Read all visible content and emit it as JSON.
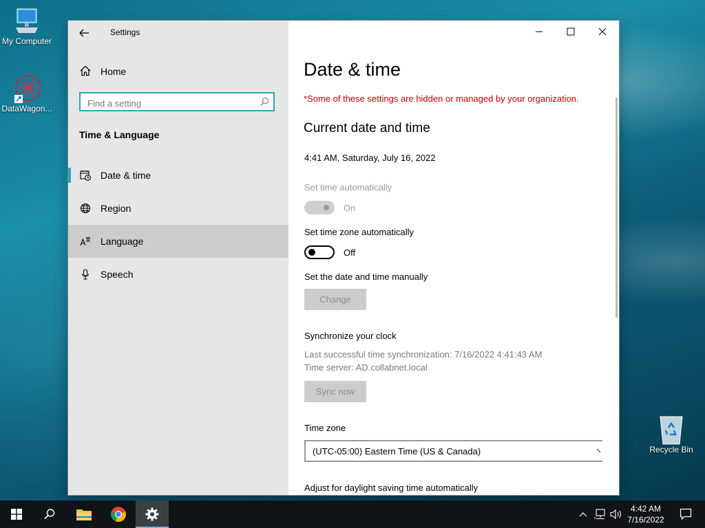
{
  "desktop": {
    "icons": [
      {
        "label": "My Computer",
        "icon": "computer-icon"
      },
      {
        "label": "DataWagon...",
        "icon": "datawagon-icon"
      },
      {
        "label": "Recycle Bin",
        "icon": "recycle-bin-icon"
      }
    ]
  },
  "window": {
    "title": "Settings",
    "controls": {
      "minimize": "minimize-icon",
      "maximize": "maximize-icon",
      "close": "close-icon"
    }
  },
  "sidebar": {
    "home_label": "Home",
    "search_placeholder": "Find a setting",
    "section_title": "Time & Language",
    "items": [
      {
        "label": "Date & time",
        "icon": "calendar-clock-icon",
        "selected": true
      },
      {
        "label": "Region",
        "icon": "globe-icon"
      },
      {
        "label": "Language",
        "icon": "language-icon",
        "hover": true
      },
      {
        "label": "Speech",
        "icon": "microphone-icon"
      }
    ]
  },
  "content": {
    "page_title": "Date & time",
    "org_notice": "*Some of these settings are hidden or managed by your organization.",
    "current_heading": "Current date and time",
    "current_value": "4:41 AM, Saturday, July 16, 2022",
    "set_time_auto": {
      "label": "Set time automatically",
      "state": "On"
    },
    "set_tz_auto": {
      "label": "Set time zone automatically",
      "state": "Off"
    },
    "manual": {
      "label": "Set the date and time manually",
      "button": "Change"
    },
    "sync": {
      "heading": "Synchronize your clock",
      "last_sync": "Last successful time synchronization: 7/16/2022 4:41:43 AM",
      "server": "Time server: AD.collabnet.local",
      "button": "Sync now"
    },
    "timezone": {
      "label": "Time zone",
      "value": "(UTC-05:00) Eastern Time (US & Canada)"
    },
    "dst_label": "Adjust for daylight saving time automatically"
  },
  "taskbar": {
    "time": "4:42 AM",
    "date": "7/16/2022"
  },
  "colors": {
    "accent": "#2aa6b8",
    "notice": "#c00000",
    "sidebar_bg": "#e6e6e6",
    "hover_bg": "#cccccc"
  }
}
